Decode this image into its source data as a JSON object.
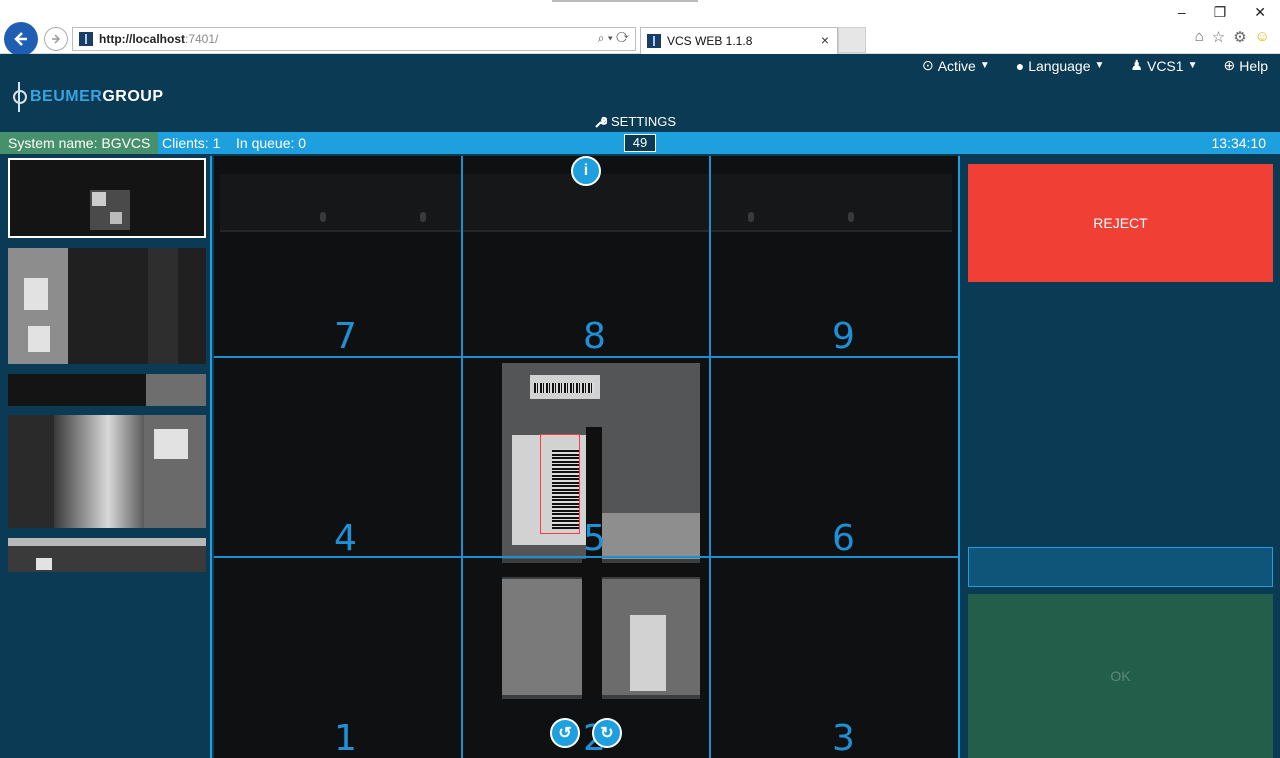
{
  "browser": {
    "url_host": "http://localhost",
    "url_port": ":7401/",
    "search_icons": "⌕ ▾ ⟳",
    "tab_title": "VCS WEB 1.1.8",
    "tab_close": "×",
    "win_minimize": "–",
    "win_restore": "❐",
    "win_close": "✕",
    "home_icon": "⌂",
    "star_icon": "☆",
    "gear_icon": "⚙",
    "smile_icon": "☺"
  },
  "header": {
    "brand_part1": "BEUMER",
    "brand_part2": "GROUP",
    "nav": {
      "active": "Active",
      "language": "Language",
      "user": "VCS1",
      "help": "Help"
    },
    "settings": "SETTINGS"
  },
  "status": {
    "system_name": "System name: BGVCS",
    "clients": "Clients: 1",
    "queue": "In queue: 0",
    "counter": "49",
    "time": "13:34:10"
  },
  "grid": {
    "cells": [
      "7",
      "8",
      "9",
      "4",
      "5",
      "6",
      "1",
      "2",
      "3"
    ]
  },
  "actions": {
    "reject": "REJECT",
    "ok": "OK",
    "code_value": ""
  },
  "colors": {
    "background": "#0b3a54",
    "accent": "#1ea0df",
    "system_name_bg": "#46916b",
    "reject": "#f04036",
    "ok": "#225e49"
  },
  "icons": {
    "info": "i",
    "rotate_left": "↺",
    "rotate_right": "↻",
    "wrench": "🔧"
  }
}
